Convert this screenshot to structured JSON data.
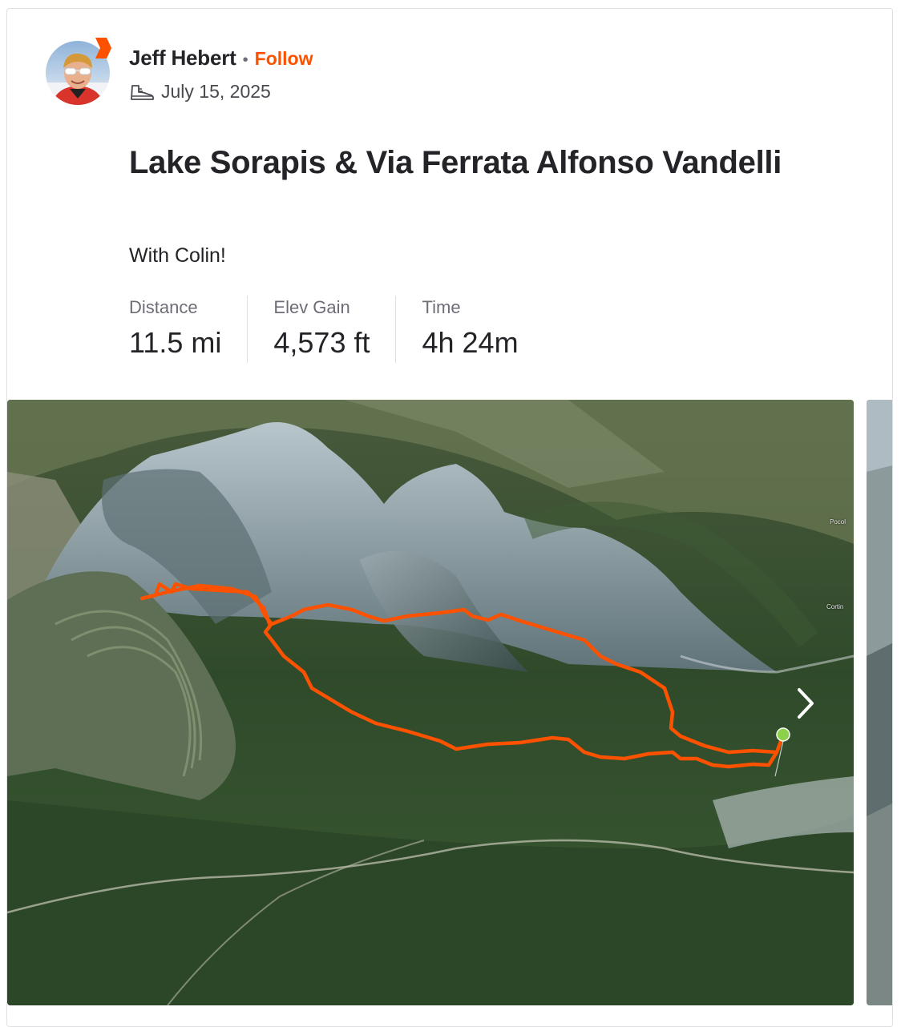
{
  "athlete": {
    "name": "Jeff Hebert",
    "follow_label": "Follow",
    "separator": "•"
  },
  "activity": {
    "date": "July 15, 2025",
    "type_icon": "hiking-shoe-icon",
    "title": "Lake Sorapis & Via Ferrata Alfonso Vandelli",
    "description": "With Colin!"
  },
  "stats": [
    {
      "label": "Distance",
      "value": "11.5 mi"
    },
    {
      "label": "Elev Gain",
      "value": "4,573 ft"
    },
    {
      "label": "Time",
      "value": "4h 24m"
    }
  ],
  "map": {
    "place_labels": [
      "Pocol",
      "Cortin"
    ],
    "route_color": "#fc5200",
    "start_marker_color": "#8bd14a",
    "next_icon": "chevron-right-icon"
  },
  "colors": {
    "brand": "#fc5200",
    "text": "#242428",
    "muted": "#6d6d78"
  }
}
